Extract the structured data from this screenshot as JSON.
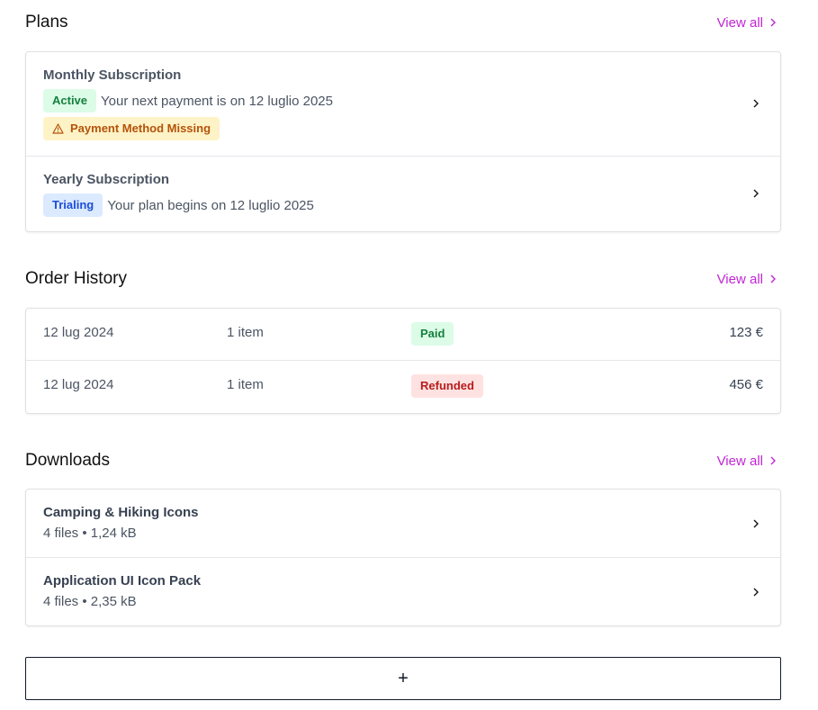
{
  "plans": {
    "title": "Plans",
    "view_all": "View all",
    "items": [
      {
        "name": "Monthly Subscription",
        "status": "Active",
        "description": "Your next payment is on 12 luglio 2025",
        "warning": "Payment Method Missing"
      },
      {
        "name": "Yearly Subscription",
        "status": "Trialing",
        "description": "Your plan begins on 12 luglio 2025"
      }
    ]
  },
  "orders": {
    "title": "Order History",
    "view_all": "View all",
    "rows": [
      {
        "date": "12 lug 2024",
        "items": "1 item",
        "status": "Paid",
        "amount": "123 €"
      },
      {
        "date": "12 lug 2024",
        "items": "1 item",
        "status": "Refunded",
        "amount": "456 €"
      }
    ]
  },
  "downloads": {
    "title": "Downloads",
    "view_all": "View all",
    "items": [
      {
        "name": "Camping & Hiking Icons",
        "meta": "4 files • 1,24 kB"
      },
      {
        "name": "Application UI Icon Pack",
        "meta": "4 files • 2,35 kB"
      }
    ]
  },
  "add_button": {
    "label": "+"
  },
  "colors": {
    "accent": "#c026d3",
    "active_bg": "#dcfce7",
    "active_text": "#15803d",
    "trialing_bg": "#dbeafe",
    "trialing_text": "#1d4ed8",
    "refunded_bg": "#fee2e2",
    "refunded_text": "#b91c1c",
    "warning_bg": "#fef3c7",
    "warning_text": "#b45309"
  },
  "icons": {
    "view_all": "chevron-right-icon",
    "row": "chevron-right-icon",
    "warning": "warning-triangle-icon"
  }
}
